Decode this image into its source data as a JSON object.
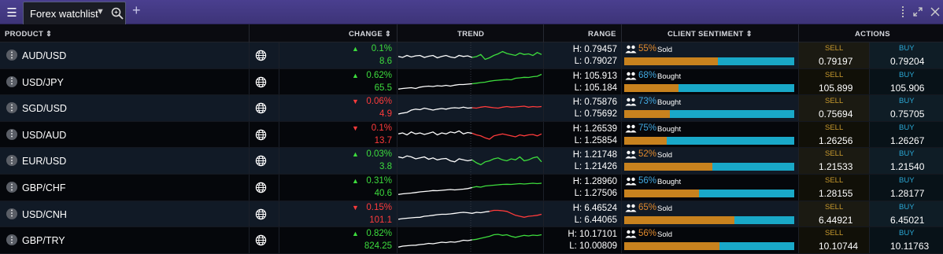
{
  "window": {
    "tab_label": "Forex watchlist",
    "icons": [
      "hamburger-icon",
      "chevron-down-icon",
      "search-icon",
      "plus-icon",
      "more-vertical-icon",
      "expand-icon",
      "close-icon"
    ]
  },
  "columns": {
    "product": "PRODUCT",
    "change": "CHANGE",
    "trend": "TREND",
    "range": "RANGE",
    "sentiment": "CLIENT SENTIMENT",
    "actions": "ACTIONS",
    "sort_glyph": "⇕"
  },
  "colors": {
    "up": "#3ddc3d",
    "down": "#ff3b3b",
    "bought_pct": "#41a8e0",
    "sold_pct": "#e0892d",
    "sell_bar": "#c8821e",
    "buy_bar": "#19a8c8"
  },
  "rows": [
    {
      "product": "AUD/USD",
      "dir": "up",
      "change_pct": "0.1%",
      "change_pts": "8.6",
      "high": "H: 0.79457",
      "low": "L: 0.79027",
      "sentiment_pct": "55%",
      "sentiment_label": "Sold",
      "sell_share": 0.55,
      "sell_label": "SELL",
      "sell": "0.79197",
      "buy_label": "BUY",
      "buy": "0.79204",
      "trend": [
        0.55,
        0.6,
        0.5,
        0.58,
        0.52,
        0.5,
        0.6,
        0.54,
        0.5,
        0.62,
        0.55,
        0.5,
        0.58,
        0.62,
        0.5,
        0.55,
        0.52,
        0.6,
        0.56,
        0.45,
        0.7,
        0.62,
        0.5,
        0.42,
        0.3,
        0.4,
        0.45,
        0.5,
        0.38,
        0.45,
        0.42,
        0.5,
        0.35,
        0.45
      ],
      "trend_split": 17
    },
    {
      "product": "USD/JPY",
      "dir": "up",
      "change_pct": "0.62%",
      "change_pts": "65.5",
      "high": "H: 105.913",
      "low": "L: 105.184",
      "sentiment_pct": "68%",
      "sentiment_label": "Bought",
      "sell_share": 0.32,
      "sell_label": "SELL",
      "sell": "105.899",
      "buy_label": "BUY",
      "buy": "105.906",
      "trend": [
        0.85,
        0.82,
        0.8,
        0.78,
        0.82,
        0.75,
        0.72,
        0.7,
        0.72,
        0.68,
        0.7,
        0.66,
        0.7,
        0.65,
        0.62,
        0.62,
        0.6,
        0.58,
        0.55,
        0.52,
        0.5,
        0.45,
        0.42,
        0.4,
        0.38,
        0.36,
        0.38,
        0.3,
        0.28,
        0.25,
        0.26,
        0.22,
        0.2,
        0.1
      ],
      "trend_split": 17
    },
    {
      "product": "SGD/USD",
      "dir": "down",
      "change_pct": "0.06%",
      "change_pts": "4.9",
      "high": "H: 0.75876",
      "low": "L: 0.75692",
      "sentiment_pct": "73%",
      "sentiment_label": "Bought",
      "sell_share": 0.27,
      "sell_label": "SELL",
      "sell": "0.75694",
      "buy_label": "BUY",
      "buy": "0.75705",
      "trend": [
        0.8,
        0.75,
        0.72,
        0.6,
        0.55,
        0.58,
        0.5,
        0.55,
        0.6,
        0.55,
        0.52,
        0.55,
        0.5,
        0.48,
        0.5,
        0.45,
        0.5,
        0.48,
        0.5,
        0.45,
        0.42,
        0.45,
        0.48,
        0.5,
        0.45,
        0.42,
        0.45,
        0.44,
        0.42,
        0.4,
        0.45,
        0.42,
        0.44,
        0.42
      ],
      "trend_split": 17
    },
    {
      "product": "USD/AUD",
      "dir": "down",
      "change_pct": "0.1%",
      "change_pts": "13.7",
      "high": "H: 1.26539",
      "low": "L: 1.25854",
      "sentiment_pct": "75%",
      "sentiment_label": "Bought",
      "sell_share": 0.25,
      "sell_label": "SELL",
      "sell": "1.26256",
      "buy_label": "BUY",
      "buy": "1.26267",
      "trend": [
        0.45,
        0.4,
        0.5,
        0.35,
        0.45,
        0.4,
        0.48,
        0.42,
        0.35,
        0.5,
        0.4,
        0.45,
        0.35,
        0.4,
        0.3,
        0.45,
        0.38,
        0.42,
        0.5,
        0.55,
        0.65,
        0.72,
        0.55,
        0.5,
        0.45,
        0.5,
        0.55,
        0.6,
        0.5,
        0.55,
        0.5,
        0.48,
        0.55,
        0.45
      ],
      "trend_split": 17
    },
    {
      "product": "EUR/USD",
      "dir": "up",
      "change_pct": "0.03%",
      "change_pts": "3.8",
      "high": "H: 1.21748",
      "low": "L: 1.21426",
      "sentiment_pct": "52%",
      "sentiment_label": "Sold",
      "sell_share": 0.52,
      "sell_label": "SELL",
      "sell": "1.21533",
      "buy_label": "BUY",
      "buy": "1.21540",
      "trend": [
        0.3,
        0.35,
        0.25,
        0.3,
        0.4,
        0.35,
        0.3,
        0.42,
        0.35,
        0.45,
        0.4,
        0.38,
        0.5,
        0.55,
        0.4,
        0.45,
        0.5,
        0.45,
        0.6,
        0.7,
        0.55,
        0.5,
        0.4,
        0.35,
        0.45,
        0.5,
        0.4,
        0.45,
        0.3,
        0.5,
        0.45,
        0.35,
        0.3,
        0.55
      ],
      "trend_split": 17
    },
    {
      "product": "GBP/CHF",
      "dir": "up",
      "change_pct": "0.31%",
      "change_pts": "40.6",
      "high": "H: 1.28960",
      "low": "L: 1.27506",
      "sentiment_pct": "56%",
      "sentiment_label": "Bought",
      "sell_share": 0.44,
      "sell_label": "SELL",
      "sell": "1.28155",
      "buy_label": "BUY",
      "buy": "1.28177",
      "trend": [
        0.85,
        0.82,
        0.8,
        0.78,
        0.75,
        0.72,
        0.7,
        0.68,
        0.65,
        0.66,
        0.64,
        0.62,
        0.6,
        0.62,
        0.6,
        0.58,
        0.55,
        0.5,
        0.45,
        0.48,
        0.42,
        0.4,
        0.38,
        0.36,
        0.34,
        0.33,
        0.34,
        0.32,
        0.3,
        0.32,
        0.3,
        0.28,
        0.3,
        0.28
      ],
      "trend_split": 17
    },
    {
      "product": "USD/CNH",
      "dir": "down",
      "change_pct": "0.15%",
      "change_pts": "101.1",
      "high": "H: 6.46524",
      "low": "L: 6.44065",
      "sentiment_pct": "65%",
      "sentiment_label": "Sold",
      "sell_share": 0.65,
      "sell_label": "SELL",
      "sell": "6.44921",
      "buy_label": "BUY",
      "buy": "6.45021",
      "trend": [
        0.75,
        0.72,
        0.7,
        0.68,
        0.66,
        0.65,
        0.6,
        0.58,
        0.55,
        0.52,
        0.5,
        0.5,
        0.48,
        0.45,
        0.42,
        0.4,
        0.42,
        0.45,
        0.4,
        0.42,
        0.38,
        0.35,
        0.3,
        0.3,
        0.32,
        0.35,
        0.45,
        0.55,
        0.6,
        0.65,
        0.6,
        0.58,
        0.55,
        0.5
      ],
      "trend_split": 21
    },
    {
      "product": "GBP/TRY",
      "dir": "up",
      "change_pct": "0.82%",
      "change_pts": "824.25",
      "high": "H: 10.17101",
      "low": "L: 10.00809",
      "sentiment_pct": "56%",
      "sentiment_label": "Sold",
      "sell_share": 0.56,
      "sell_label": "SELL",
      "sell": "10.10744",
      "buy_label": "BUY",
      "buy": "10.11763",
      "trend": [
        0.85,
        0.8,
        0.78,
        0.76,
        0.75,
        0.72,
        0.7,
        0.66,
        0.68,
        0.64,
        0.6,
        0.62,
        0.58,
        0.6,
        0.56,
        0.5,
        0.52,
        0.48,
        0.45,
        0.4,
        0.35,
        0.3,
        0.22,
        0.2,
        0.25,
        0.22,
        0.3,
        0.35,
        0.3,
        0.25,
        0.28,
        0.24,
        0.26,
        0.22
      ],
      "trend_split": 17
    }
  ]
}
